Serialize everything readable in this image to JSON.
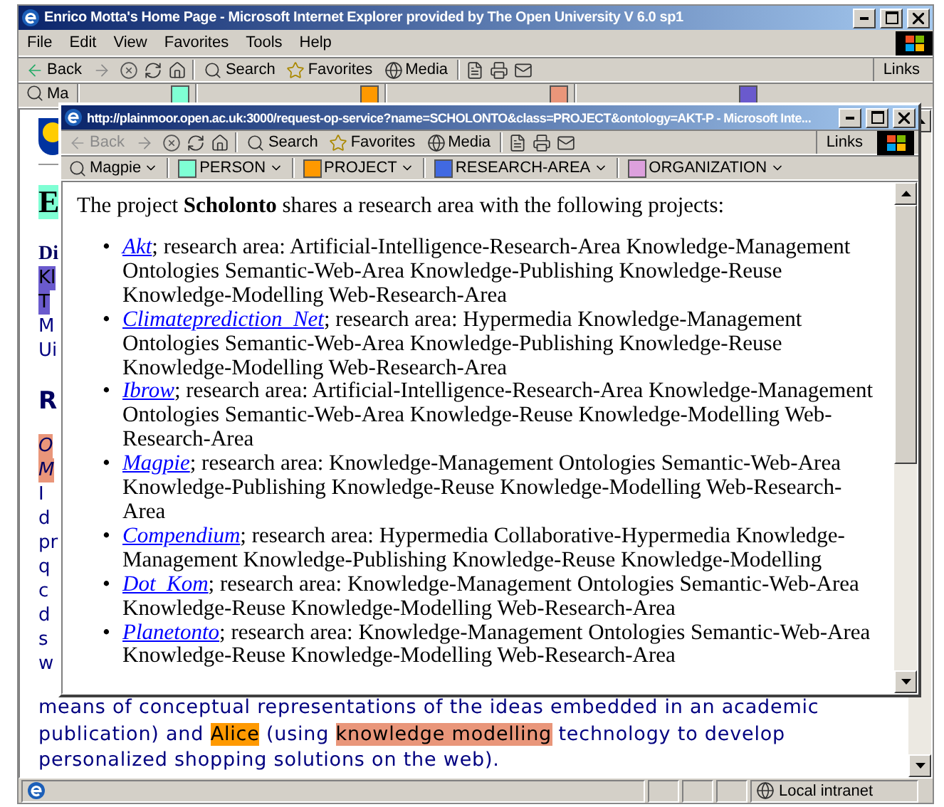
{
  "outer": {
    "title": "Enrico Motta's Home Page - Microsoft Internet Explorer provided by The Open University V 6.0 sp1",
    "menu": [
      "File",
      "Edit",
      "View",
      "Favorites",
      "Tools",
      "Help"
    ],
    "toolbar": {
      "back": "Back",
      "search": "Search",
      "favorites": "Favorites",
      "media": "Media",
      "links": "Links"
    },
    "bookmark_label": "Ma",
    "bookmark_swatches": [
      {
        "color": "#7fffd4"
      },
      {
        "color": "#ff9900"
      },
      {
        "color": "#e9967a"
      },
      {
        "color": "#6a5acd"
      }
    ],
    "page_fragments": [
      {
        "text": "E",
        "kind": "heading"
      },
      {
        "text": "Di",
        "kind": "bold"
      },
      {
        "text": "Kl",
        "kind": "purple"
      },
      {
        "text": "T",
        "kind": "purple"
      },
      {
        "text": "M",
        "kind": "plain"
      },
      {
        "text": "Ui",
        "kind": "plain"
      },
      {
        "text": "R",
        "kind": "subheading"
      },
      {
        "text": "O",
        "kind": "salmon"
      },
      {
        "text": "M",
        "kind": "salmon"
      },
      {
        "text": "I",
        "kind": "plain"
      },
      {
        "text": "d",
        "kind": "plain"
      },
      {
        "text": "pr",
        "kind": "plain"
      },
      {
        "text": "q",
        "kind": "plain"
      },
      {
        "text": "c",
        "kind": "plain"
      },
      {
        "text": "d",
        "kind": "plain"
      },
      {
        "text": "s",
        "kind": "plain"
      },
      {
        "text": "w",
        "kind": "plain"
      }
    ],
    "paragraph_lines": [
      {
        "segments": [
          {
            "text": "means of conceptual representations of the ideas embedded in an academic",
            "kind": "plain"
          }
        ]
      },
      {
        "segments": [
          {
            "text": "publication) and ",
            "kind": "plain"
          },
          {
            "text": "Alice",
            "kind": "orange"
          },
          {
            "text": " (using ",
            "kind": "plain"
          },
          {
            "text": "knowledge modelling",
            "kind": "salmon"
          },
          {
            "text": " technology to develop",
            "kind": "plain"
          }
        ]
      },
      {
        "segments": [
          {
            "text": "personalized shopping solutions on the web).",
            "kind": "plain"
          }
        ]
      }
    ],
    "status": "Local intranet"
  },
  "popup": {
    "title": "http://plainmoor.open.ac.uk:3000/request-op-service?name=SCHOLONTO&class=PROJECT&ontology=AKT-P - Microsoft Inte...",
    "toolbar": {
      "back": {
        "label": "Back",
        "disabled": true
      },
      "search": "Search",
      "favorites": "Favorites",
      "media": "Media",
      "links": "Links"
    },
    "magpie": "Magpie",
    "categories": [
      {
        "label": "PERSON",
        "color": "#7fffd4"
      },
      {
        "label": "PROJECT",
        "color": "#ff9900"
      },
      {
        "label": "RESEARCH-AREA",
        "color": "#4169e1"
      },
      {
        "label": "ORGANIZATION",
        "color": "#dda0dd"
      }
    ],
    "intro": "The project **Scholonto** shares a research area with the following projects:",
    "projects": [
      {
        "bullet": "•",
        "name": "Akt",
        "description": "; research area: Artificial-Intelligence-Research-Area Knowledge-Management Ontologies Semantic-Web-Area Knowledge-Publishing Knowledge-Reuse Knowledge-Modelling Web-Research-Area"
      },
      {
        "bullet": "•",
        "name": "Climateprediction_Net",
        "description": "; research area: Hypermedia Knowledge-Management Ontologies Semantic-Web-Area Knowledge-Publishing Knowledge-Reuse Knowledge-Modelling Web-Research-Area"
      },
      {
        "bullet": "•",
        "name": "Ibrow",
        "description": "; research area: Artificial-Intelligence-Research-Area Knowledge-Management Ontologies Semantic-Web-Area Knowledge-Reuse Knowledge-Modelling Web-Research-Area"
      },
      {
        "bullet": "•",
        "name": "Magpie",
        "description": "; research area: Knowledge-Management Ontologies Semantic-Web-Area Knowledge-Publishing Knowledge-Reuse Knowledge-Modelling Web-Research-Area"
      },
      {
        "bullet": "•",
        "name": "Compendium",
        "description": "; research area: Hypermedia Collaborative-Hypermedia Knowledge-Management Knowledge-Publishing Knowledge-Reuse Knowledge-Modelling"
      },
      {
        "bullet": "•",
        "name": "Dot_Kom",
        "description": "; research area: Knowledge-Management Ontologies Semantic-Web-Area Knowledge-Reuse Knowledge-Modelling Web-Research-Area"
      },
      {
        "bullet": "•",
        "name": "Planetonto",
        "description": "; research area: Knowledge-Management Ontologies Semantic-Web-Area Knowledge-Reuse Knowledge-Modelling Web-Research-Area"
      }
    ]
  }
}
